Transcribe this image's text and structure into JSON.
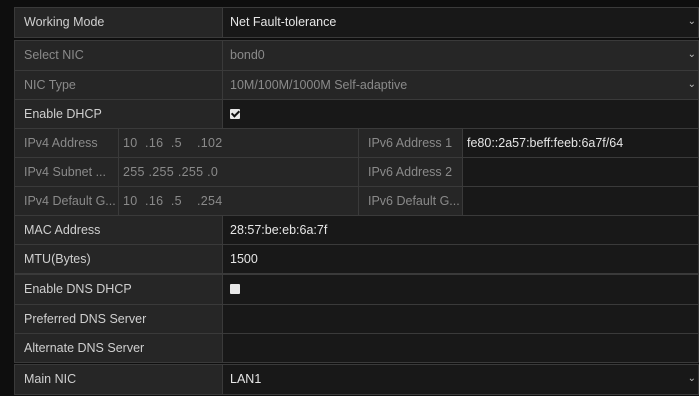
{
  "working_mode": {
    "label": "Working Mode",
    "value": "Net Fault-tolerance"
  },
  "select_nic": {
    "label": "Select NIC",
    "value": "bond0"
  },
  "nic_type": {
    "label": "NIC Type",
    "value": "10M/100M/1000M Self-adaptive"
  },
  "enable_dhcp": {
    "label": "Enable DHCP",
    "checked": true
  },
  "ipv4_address": {
    "label": "IPv4 Address",
    "value": "10  .16  .5    .102"
  },
  "ipv6_address_1": {
    "label": "IPv6 Address 1",
    "value": "fe80::2a57:beff:feeb:6a7f/64"
  },
  "ipv4_subnet": {
    "label": "IPv4 Subnet ...",
    "value": "255 .255 .255 .0"
  },
  "ipv6_address_2": {
    "label": "IPv6 Address 2",
    "value": ""
  },
  "ipv4_gateway": {
    "label": "IPv4 Default G...",
    "value": "10  .16  .5    .254"
  },
  "ipv6_gateway": {
    "label": "IPv6 Default G...",
    "value": ""
  },
  "mac_address": {
    "label": "MAC Address",
    "value": "28:57:be:eb:6a:7f"
  },
  "mtu": {
    "label": "MTU(Bytes)",
    "value": "1500"
  },
  "enable_dns_dhcp": {
    "label": "Enable DNS DHCP",
    "checked": false
  },
  "preferred_dns": {
    "label": "Preferred DNS Server",
    "value": ""
  },
  "alternate_dns": {
    "label": "Alternate DNS Server",
    "value": ""
  },
  "main_nic": {
    "label": "Main NIC",
    "value": "LAN1"
  },
  "icons": {
    "dropdown": "chevron-down-icon",
    "checkbox": "checkbox-icon"
  },
  "colors": {
    "background": "#0e0e0e",
    "panel": "#232323",
    "border": "#3a3a3a",
    "text": "#e6e6e6",
    "dim_text": "#8a8a8a"
  }
}
